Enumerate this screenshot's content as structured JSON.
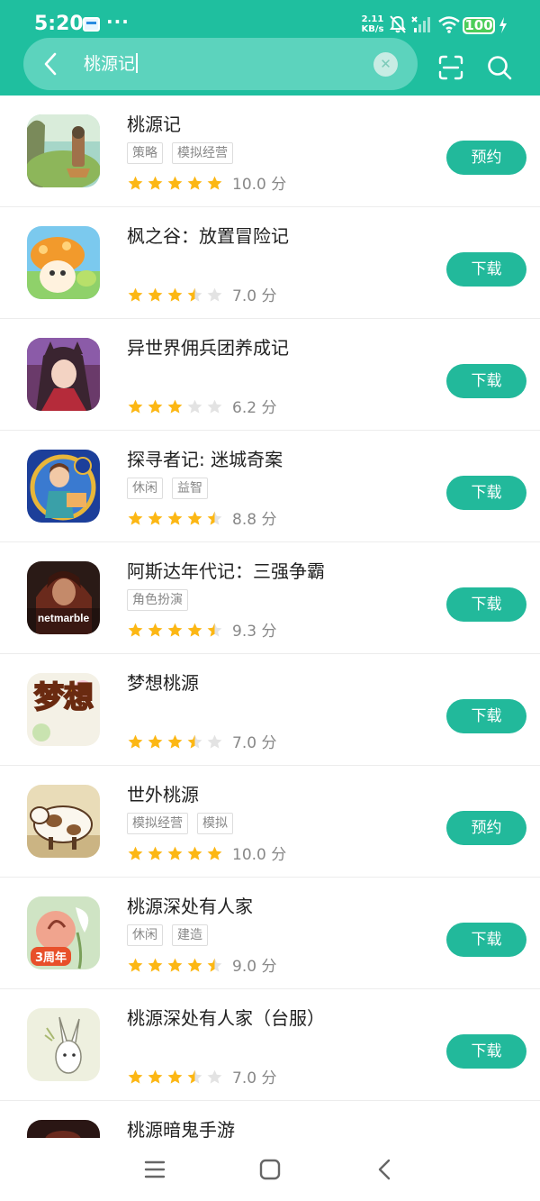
{
  "status_bar": {
    "time": "5:20",
    "dots": "···",
    "speed_value": "2.11",
    "speed_unit": "KB/s",
    "battery": "100"
  },
  "search": {
    "query": "桃源记"
  },
  "colors": {
    "brand": "#1fbf9f",
    "button": "#22b99b",
    "star_on": "#fcb714",
    "star_off": "#e3e3e3"
  },
  "results": [
    {
      "name": "桃源记",
      "tags": [
        "策略",
        "模拟经营"
      ],
      "rating": 5,
      "score": "10.0 分",
      "action": "预约",
      "icon": "peach-garden-icon"
    },
    {
      "name": "枫之谷：放置冒险记",
      "tags": [],
      "rating": 3.5,
      "score": "7.0 分",
      "action": "下载",
      "icon": "mushroom-icon"
    },
    {
      "name": "异世界佣兵团养成记",
      "tags": [],
      "rating": 3,
      "score": "6.2 分",
      "action": "下载",
      "icon": "anime-girl-icon"
    },
    {
      "name": "探寻者记: 迷城奇案",
      "tags": [
        "休闲",
        "益智"
      ],
      "rating": 4.5,
      "score": "8.8 分",
      "action": "下载",
      "icon": "detective-icon"
    },
    {
      "name": "阿斯达年代记：三强争霸",
      "tags": [
        "角色扮演"
      ],
      "rating": 4.5,
      "score": "9.3 分",
      "action": "下载",
      "icon": "netmarble-icon",
      "icon_text": "netmarble"
    },
    {
      "name": "梦想桃源",
      "tags": [],
      "rating": 3.5,
      "score": "7.0 分",
      "action": "下载",
      "icon": "dream-icon",
      "icon_text": "梦想"
    },
    {
      "name": "世外桃源",
      "tags": [
        "模拟经营",
        "模拟"
      ],
      "rating": 5,
      "score": "10.0 分",
      "action": "预约",
      "icon": "cow-icon"
    },
    {
      "name": "桃源深处有人家",
      "tags": [
        "休闲",
        "建造"
      ],
      "rating": 4.5,
      "score": "9.0 分",
      "action": "下载",
      "icon": "peach-bird-icon",
      "icon_text": "3周年"
    },
    {
      "name": "桃源深处有人家（台服）",
      "tags": [],
      "rating": 3.5,
      "score": "7.0 分",
      "action": "下载",
      "icon": "rabbit-icon"
    },
    {
      "name": "桃源暗鬼手游",
      "tags": [],
      "rating": 0,
      "score": "",
      "action": "",
      "icon": "dark-icon"
    }
  ]
}
